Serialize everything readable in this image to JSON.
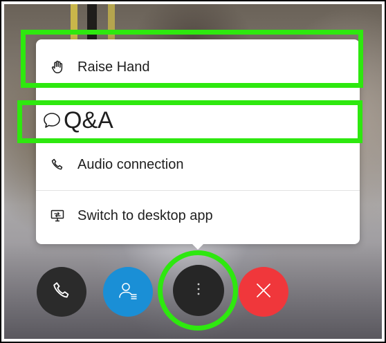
{
  "menu": {
    "items": [
      {
        "id": "raise-hand",
        "label": "Raise Hand",
        "icon": "hand-icon"
      },
      {
        "id": "qa",
        "label": "Q&A",
        "icon": "speech-bubble-icon"
      },
      {
        "id": "audio-connection",
        "label": "Audio connection",
        "icon": "phone-icon"
      },
      {
        "id": "switch-desktop",
        "label": "Switch to desktop app",
        "icon": "desktop-app-icon"
      }
    ]
  },
  "controls": [
    {
      "id": "call",
      "icon": "phone-icon",
      "color": "#2b2b2b"
    },
    {
      "id": "participants",
      "icon": "participants-icon",
      "color": "#1a8fd6"
    },
    {
      "id": "more",
      "icon": "more-vertical-icon",
      "color": "#262626"
    },
    {
      "id": "leave",
      "icon": "close-icon",
      "color": "#f0373b"
    }
  ],
  "highlight_color": "#2ee80f"
}
